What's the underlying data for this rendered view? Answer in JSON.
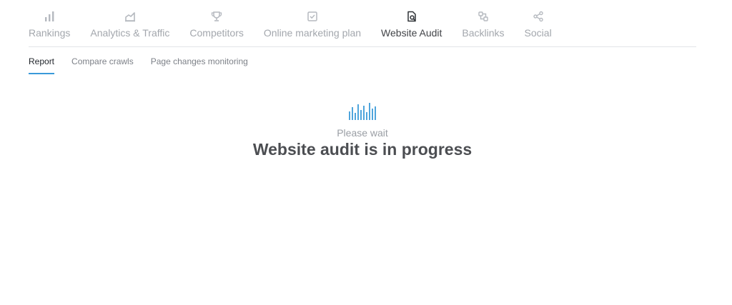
{
  "nav": {
    "items": [
      {
        "label": "Rankings",
        "icon": "bar-chart-icon"
      },
      {
        "label": "Analytics & Traffic",
        "icon": "traffic-chart-icon"
      },
      {
        "label": "Competitors",
        "icon": "trophy-icon"
      },
      {
        "label": "Online marketing plan",
        "icon": "checkbox-icon"
      },
      {
        "label": "Website Audit",
        "icon": "audit-document-icon",
        "active": true
      },
      {
        "label": "Backlinks",
        "icon": "backlinks-icon"
      },
      {
        "label": "Social",
        "icon": "share-icon"
      }
    ]
  },
  "subtabs": [
    {
      "label": "Report",
      "active": true
    },
    {
      "label": "Compare crawls"
    },
    {
      "label": "Page changes monitoring"
    }
  ],
  "status": {
    "subtitle": "Please wait",
    "title": "Website audit is in progress",
    "icon": "loading-bars-icon"
  },
  "colors": {
    "accent": "#3a9ad9",
    "inactive_nav": "#a3a7ad",
    "active_nav": "#424448"
  }
}
